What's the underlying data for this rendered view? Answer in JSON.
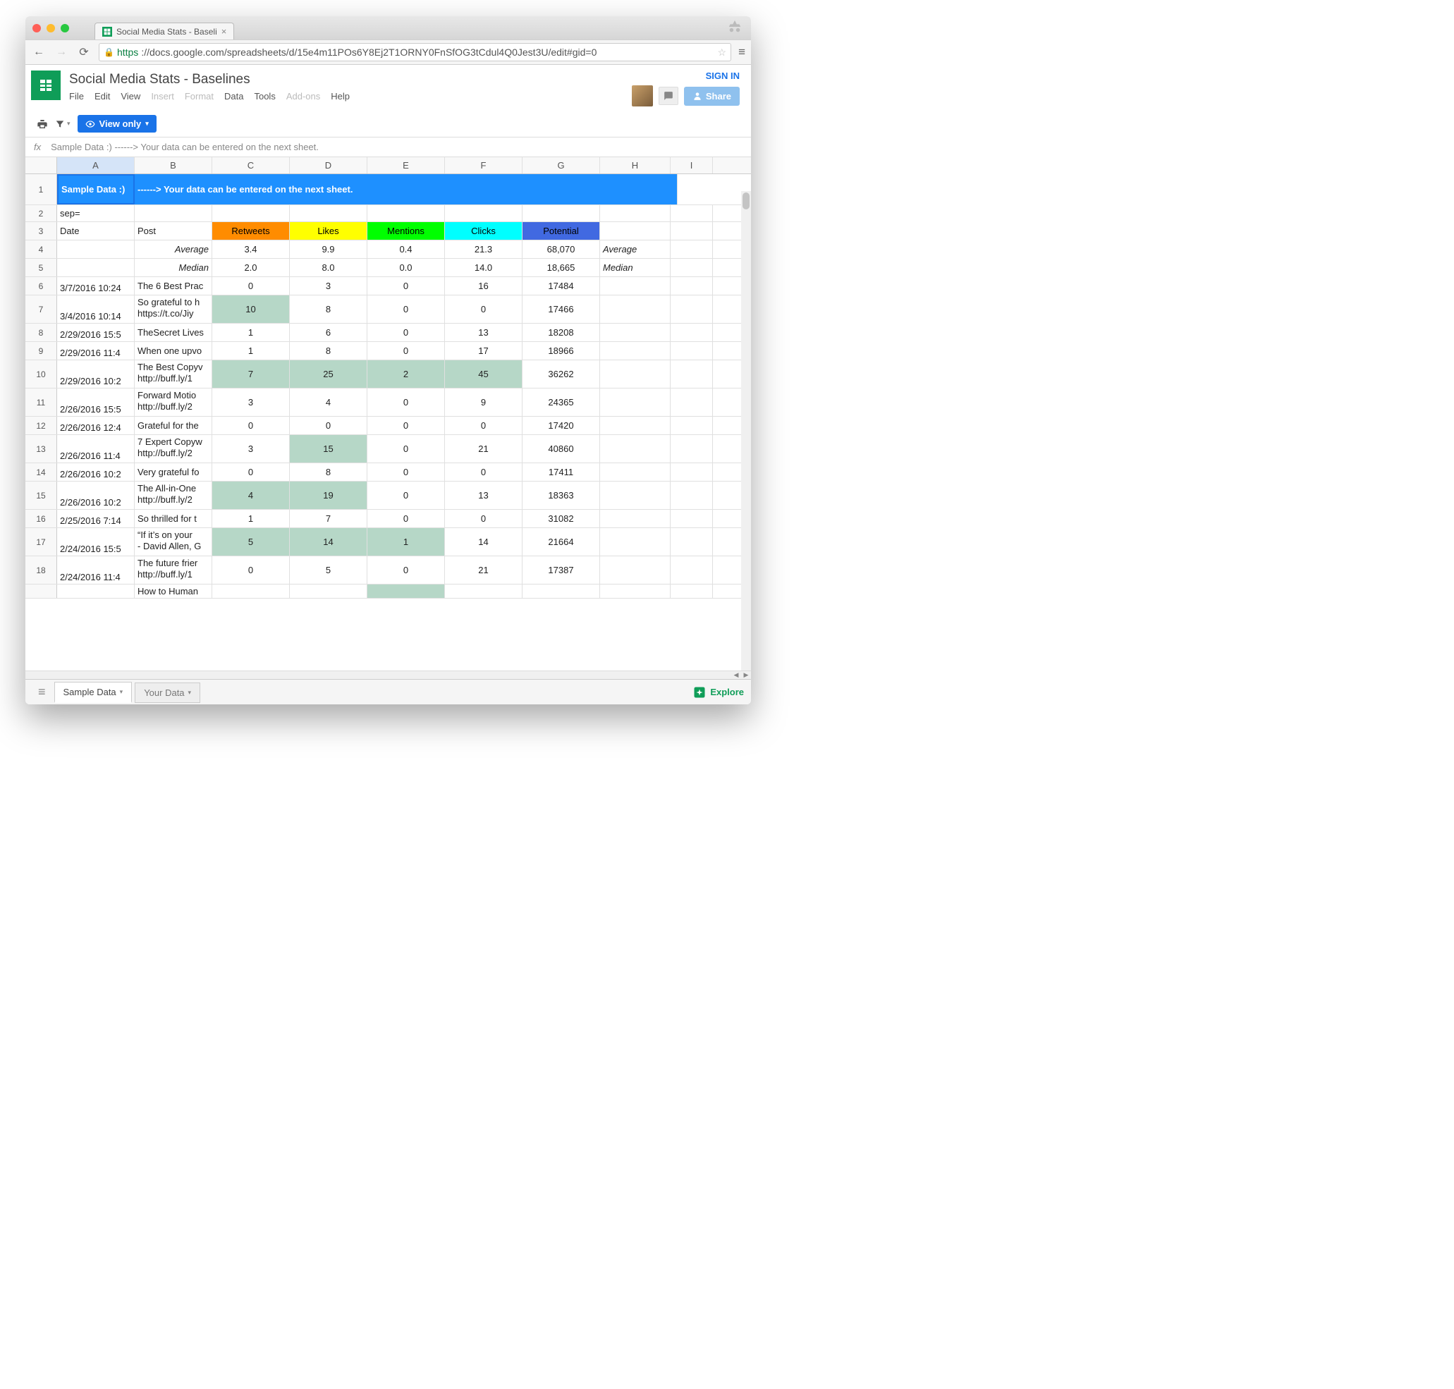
{
  "browser": {
    "tab_title": "Social Media Stats - Baseli",
    "url_protocol": "https",
    "url_rest": "://docs.google.com/spreadsheets/d/15e4m11POs6Y8Ej2T1ORNY0FnSfOG3tCdul4Q0Jest3U/edit#gid=0"
  },
  "docs": {
    "title": "Social Media Stats - Baselines",
    "signin": "SIGN IN",
    "share": "Share",
    "menu": {
      "file": "File",
      "edit": "Edit",
      "view": "View",
      "insert": "Insert",
      "format": "Format",
      "data": "Data",
      "tools": "Tools",
      "addons": "Add-ons",
      "help": "Help"
    },
    "view_only": "View only"
  },
  "formula_bar": "Sample Data :)  ------>  Your data can be entered on the next sheet.",
  "columns": [
    "A",
    "B",
    "C",
    "D",
    "E",
    "F",
    "G",
    "H",
    "I"
  ],
  "banner": {
    "a": "Sample Data :)",
    "rest": "------>  Your data can be entered on the next sheet."
  },
  "row2": {
    "a": "sep="
  },
  "headers": {
    "a": "Date",
    "b": "Post",
    "c": "Retweets",
    "d": "Likes",
    "e": "Mentions",
    "f": "Clicks",
    "g": "Potential"
  },
  "summary": {
    "avg_label": "Average",
    "med_label": "Median",
    "avg": {
      "c": "3.4",
      "d": "9.9",
      "e": "0.4",
      "f": "21.3",
      "g": "68,070"
    },
    "med": {
      "c": "2.0",
      "d": "8.0",
      "e": "0.0",
      "f": "14.0",
      "g": "18,665"
    },
    "avg_h": "Average",
    "med_h": "Median"
  },
  "rows": [
    {
      "n": "6",
      "h": 26,
      "date": "3/7/2016 10:24",
      "post": "The 6 Best Prac",
      "c": "0",
      "d": "3",
      "e": "0",
      "f": "16",
      "g": "17484"
    },
    {
      "n": "7",
      "h": 40,
      "date": "3/4/2016 10:14",
      "post": "So grateful to h\nhttps://t.co/Jiy",
      "c": "10",
      "d": "8",
      "e": "0",
      "f": "0",
      "g": "17466",
      "hl_c": true
    },
    {
      "n": "8",
      "h": 26,
      "date": "2/29/2016 15:5",
      "post": "TheSecret Lives",
      "c": "1",
      "d": "6",
      "e": "0",
      "f": "13",
      "g": "18208"
    },
    {
      "n": "9",
      "h": 26,
      "date": "2/29/2016 11:4",
      "post": "When one upvo",
      "c": "1",
      "d": "8",
      "e": "0",
      "f": "17",
      "g": "18966"
    },
    {
      "n": "10",
      "h": 40,
      "date": "2/29/2016 10:2",
      "post": "The Best Copyv\nhttp://buff.ly/1",
      "c": "7",
      "d": "25",
      "e": "2",
      "f": "45",
      "g": "36262",
      "hl_c": true,
      "hl_d": true,
      "hl_e": true,
      "hl_f": true
    },
    {
      "n": "11",
      "h": 40,
      "date": "2/26/2016 15:5",
      "post": "Forward Motio\nhttp://buff.ly/2",
      "c": "3",
      "d": "4",
      "e": "0",
      "f": "9",
      "g": "24365"
    },
    {
      "n": "12",
      "h": 26,
      "date": "2/26/2016 12:4",
      "post": "Grateful for the",
      "c": "0",
      "d": "0",
      "e": "0",
      "f": "0",
      "g": "17420"
    },
    {
      "n": "13",
      "h": 40,
      "date": "2/26/2016 11:4",
      "post": "7 Expert Copyw\nhttp://buff.ly/2",
      "c": "3",
      "d": "15",
      "e": "0",
      "f": "21",
      "g": "40860",
      "hl_d": true
    },
    {
      "n": "14",
      "h": 26,
      "date": "2/26/2016 10:2",
      "post": "Very grateful fo",
      "c": "0",
      "d": "8",
      "e": "0",
      "f": "0",
      "g": "17411"
    },
    {
      "n": "15",
      "h": 40,
      "date": "2/26/2016 10:2",
      "post": "The All-in-One \nhttp://buff.ly/2",
      "c": "4",
      "d": "19",
      "e": "0",
      "f": "13",
      "g": "18363",
      "hl_c": true,
      "hl_d": true
    },
    {
      "n": "16",
      "h": 26,
      "date": "2/25/2016 7:14",
      "post": "So thrilled for t",
      "c": "1",
      "d": "7",
      "e": "0",
      "f": "0",
      "g": "31082"
    },
    {
      "n": "17",
      "h": 40,
      "date": "2/24/2016 15:5",
      "post": "“If it’s on your \n- David Allen, G",
      "c": "5",
      "d": "14",
      "e": "1",
      "f": "14",
      "g": "21664",
      "hl_c": true,
      "hl_d": true,
      "hl_e": true
    },
    {
      "n": "18",
      "h": 40,
      "date": "2/24/2016 11:4",
      "post": "The future frier\nhttp://buff.ly/1",
      "c": "0",
      "d": "5",
      "e": "0",
      "f": "21",
      "g": "17387"
    },
    {
      "n": "",
      "h": 20,
      "date": "",
      "post": "How to Human",
      "c": "",
      "d": "",
      "e": "",
      "f": "",
      "g": "",
      "hl_e": true
    }
  ],
  "tabs": {
    "active": "Sample Data",
    "other": "Your Data"
  },
  "explore": "Explore"
}
